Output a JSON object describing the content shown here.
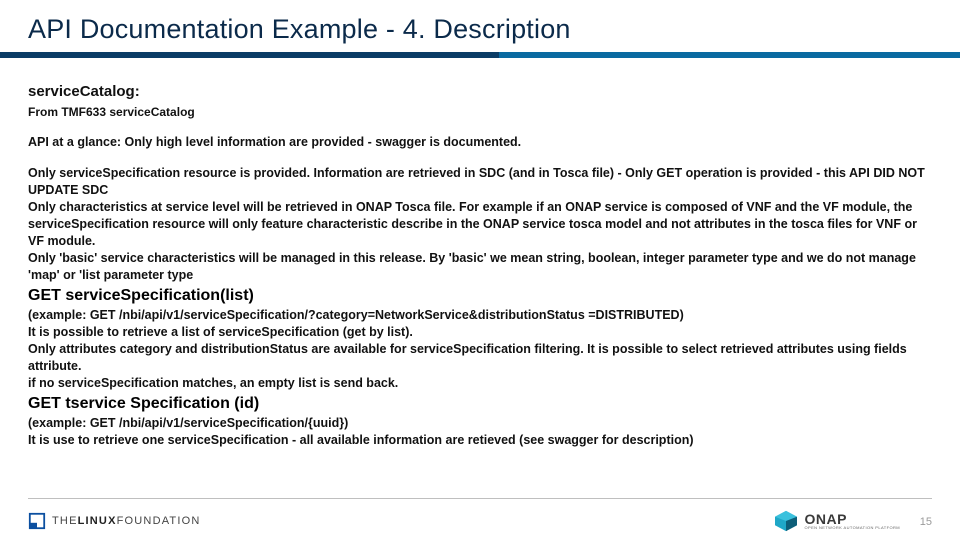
{
  "title": "API Documentation Example - 4. Description",
  "heading": "serviceCatalog:",
  "subheading": "From TMF633 serviceCatalog",
  "glance": "API at a glance: Only high level information are provided - swagger is documented.",
  "body1_a": "Only serviceSpecification resource is provided. Information are retrieved in SDC (and in Tosca file) - Only GET operation is provided - this API DID NOT UPDATE SDC",
  "body1_b": "Only characteristics at service level will be retrieved in ONAP Tosca file. For example if an ONAP service is composed of VNF and the VF module, the serviceSpecification resource will only feature characteristic describe in the ONAP service tosca model and not attributes in the tosca files for VNF or VF module.",
  "body1_c": "Only 'basic' service characteristics will be managed in this release. By 'basic' we mean string, boolean, integer parameter type and we do not manage 'map' or 'list parameter type",
  "sect1": "GET serviceSpecification(list)",
  "body2_a": "(example: GET /nbi/api/v1/serviceSpecification/?category=NetworkService&distributionStatus =DISTRIBUTED)",
  "body2_b": "It is possible to retrieve a list of serviceSpecification (get by list).",
  "body2_c": "Only attributes category and distributionStatus are available for serviceSpecification filtering. It is possible to select retrieved attributes using fields attribute.",
  "body2_d": "if no serviceSpecification matches, an empty list is send back.",
  "sect2": "GET tservice Specification (id)",
  "body3_a": "(example: GET /nbi/api/v1/serviceSpecification/{uuid})",
  "body3_b": "It is use to retrieve one serviceSpecification - all available information are retieved (see swagger for description)",
  "footer": {
    "lf_the": "THE",
    "lf_linux": "LINUX",
    "lf_foundation": "FOUNDATION",
    "onap": "ONAP",
    "onap_tag": "OPEN NETWORK AUTOMATION PLATFORM",
    "page": "15"
  }
}
